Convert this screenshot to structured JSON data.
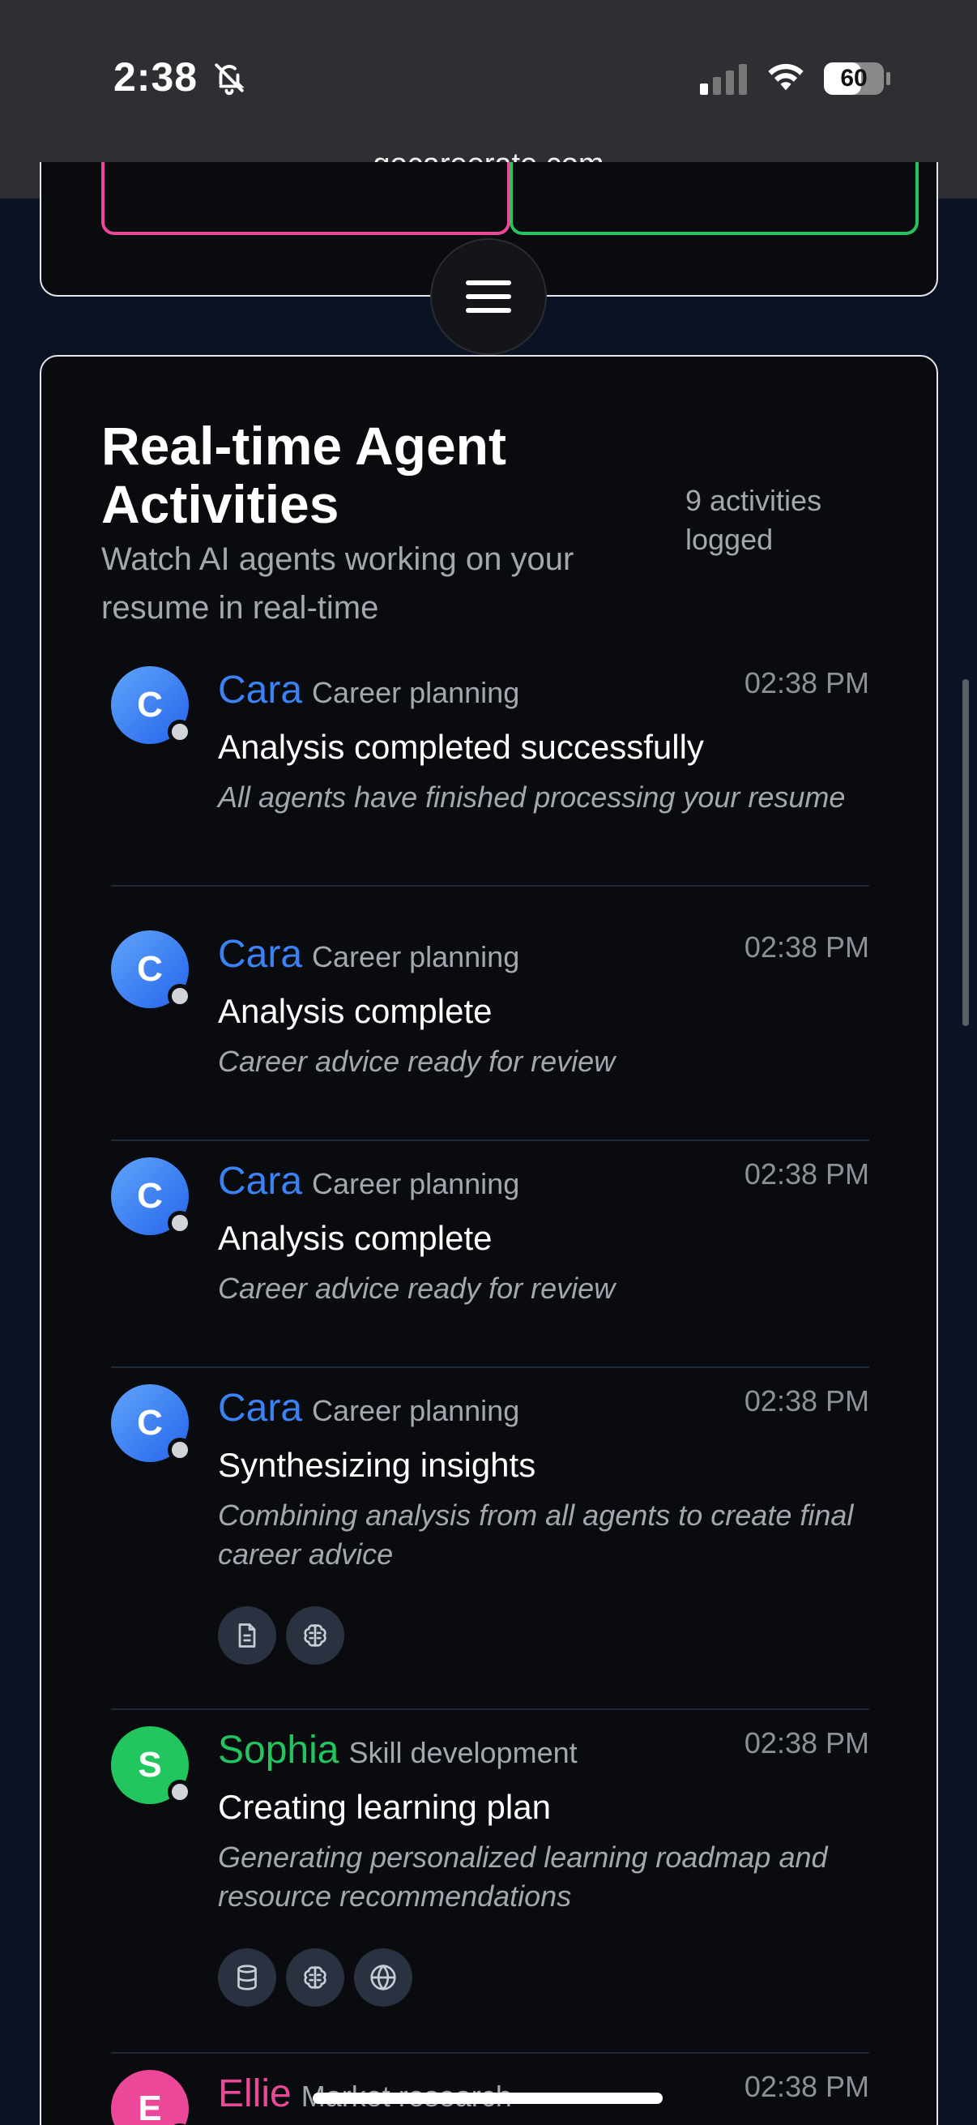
{
  "status_bar": {
    "time": "2:38",
    "battery": "60"
  },
  "browser": {
    "url": "gocareerate.com"
  },
  "activities": {
    "title": "Real-time Agent Activities",
    "subtitle": "Watch AI agents working on your resume in real-time",
    "count_label": "9 activities logged",
    "items": [
      {
        "initial": "C",
        "name": "Cara",
        "role": "Career planning",
        "time": "02:38 PM",
        "headline": "Analysis completed successfully",
        "description": "All agents have finished processing your resume",
        "tools": []
      },
      {
        "initial": "C",
        "name": "Cara",
        "role": "Career planning",
        "time": "02:38 PM",
        "headline": "Analysis complete",
        "description": "Career advice ready for review",
        "tools": []
      },
      {
        "initial": "C",
        "name": "Cara",
        "role": "Career planning",
        "time": "02:38 PM",
        "headline": "Analysis complete",
        "description": "Career advice ready for review",
        "tools": []
      },
      {
        "initial": "C",
        "name": "Cara",
        "role": "Career planning",
        "time": "02:38 PM",
        "headline": "Synthesizing insights",
        "description": "Combining analysis from all agents to create final career advice",
        "tools": [
          "document-icon",
          "brain-icon"
        ]
      },
      {
        "initial": "S",
        "name": "Sophia",
        "role": "Skill development",
        "time": "02:38 PM",
        "headline": "Creating learning plan",
        "description": "Generating personalized learning roadmap and resource recommendations",
        "tools": [
          "database-icon",
          "brain-icon",
          "globe-icon"
        ]
      },
      {
        "initial": "E",
        "name": "Ellie",
        "role": "Market research",
        "time": "02:38 PM"
      }
    ]
  },
  "colors": {
    "cara": "#3b82f6",
    "sophia": "#22c55e",
    "ellie": "#ec4899",
    "card_bg": "#0a0b0e",
    "page_bg": "#0b1224"
  }
}
